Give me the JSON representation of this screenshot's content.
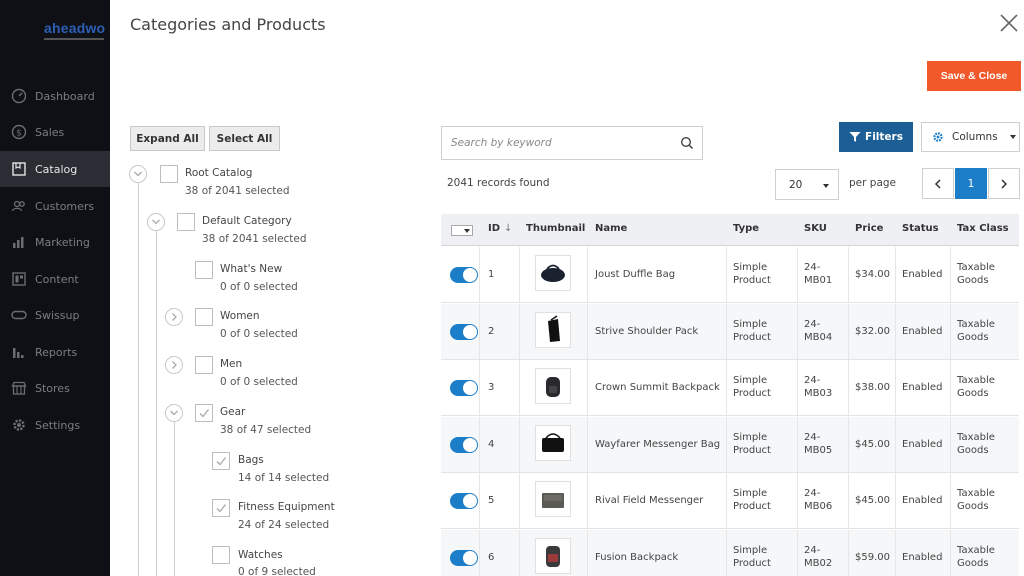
{
  "brand": {
    "logo_text": "aheadwo"
  },
  "sidebar": {
    "items": [
      {
        "label": "Dashboard",
        "icon": "dashboard-icon"
      },
      {
        "label": "Sales",
        "icon": "dollar-icon"
      },
      {
        "label": "Catalog",
        "icon": "catalog-icon",
        "active": true
      },
      {
        "label": "Customers",
        "icon": "customers-icon"
      },
      {
        "label": "Marketing",
        "icon": "marketing-icon"
      },
      {
        "label": "Content",
        "icon": "content-icon"
      },
      {
        "label": "Swissup",
        "icon": "swissup-icon"
      },
      {
        "label": "Reports",
        "icon": "reports-icon"
      },
      {
        "label": "Stores",
        "icon": "stores-icon"
      },
      {
        "label": "Settings",
        "icon": "gear-icon"
      }
    ]
  },
  "modal": {
    "title": "Categories and Products",
    "save_label": "Save & Close"
  },
  "tree": {
    "expand_all": "Expand All",
    "select_all": "Select All",
    "nodes": [
      {
        "label": "Root Catalog",
        "count": "38 of 2041 selected"
      },
      {
        "label": "Default Category",
        "count": "38 of 2041 selected"
      },
      {
        "label": "What's New",
        "count": "0 of 0 selected"
      },
      {
        "label": "Women",
        "count": "0 of 0 selected"
      },
      {
        "label": "Men",
        "count": "0 of 0 selected"
      },
      {
        "label": "Gear",
        "count": "38 of 47 selected"
      },
      {
        "label": "Bags",
        "count": "14 of 14 selected"
      },
      {
        "label": "Fitness Equipment",
        "count": "24 of 24 selected"
      },
      {
        "label": "Watches",
        "count": "0 of 9 selected"
      }
    ]
  },
  "toolbar": {
    "search_placeholder": "Search by keyword",
    "filters_label": "Filters",
    "columns_label": "Columns",
    "records_found": "2041 records found",
    "per_page_value": "20",
    "per_page_label": "per page",
    "current_page": "1"
  },
  "grid": {
    "headers": {
      "id": "ID",
      "sort": "↓",
      "thumbnail": "Thumbnail",
      "name": "Name",
      "type": "Type",
      "sku": "SKU",
      "price": "Price",
      "status": "Status",
      "tax_class": "Tax Class"
    },
    "rows": [
      {
        "id": "1",
        "name": "Joust Duffle Bag",
        "type1": "Simple",
        "type2": "Product",
        "sku1": "24-",
        "sku2": "MB01",
        "price": "$34.00",
        "status": "Enabled",
        "tax1": "Taxable",
        "tax2": "Goods",
        "thumb": "duffle-bag-icon"
      },
      {
        "id": "2",
        "name": "Strive Shoulder Pack",
        "type1": "Simple",
        "type2": "Product",
        "sku1": "24-",
        "sku2": "MB04",
        "price": "$32.00",
        "status": "Enabled",
        "tax1": "Taxable",
        "tax2": "Goods",
        "thumb": "shoulder-pack-icon"
      },
      {
        "id": "3",
        "name": "Crown Summit Backpack",
        "type1": "Simple",
        "type2": "Product",
        "sku1": "24-",
        "sku2": "MB03",
        "price": "$38.00",
        "status": "Enabled",
        "tax1": "Taxable",
        "tax2": "Goods",
        "thumb": "backpack-icon"
      },
      {
        "id": "4",
        "name": "Wayfarer Messenger Bag",
        "type1": "Simple",
        "type2": "Product",
        "sku1": "24-",
        "sku2": "MB05",
        "price": "$45.00",
        "status": "Enabled",
        "tax1": "Taxable",
        "tax2": "Goods",
        "thumb": "messenger-bag-icon"
      },
      {
        "id": "5",
        "name": "Rival Field Messenger",
        "type1": "Simple",
        "type2": "Product",
        "sku1": "24-",
        "sku2": "MB06",
        "price": "$45.00",
        "status": "Enabled",
        "tax1": "Taxable",
        "tax2": "Goods",
        "thumb": "field-messenger-icon"
      },
      {
        "id": "6",
        "name": "Fusion Backpack",
        "type1": "Simple",
        "type2": "Product",
        "sku1": "24-",
        "sku2": "MB02",
        "price": "$59.00",
        "status": "Enabled",
        "tax1": "Taxable",
        "tax2": "Goods",
        "thumb": "fusion-backpack-icon"
      }
    ]
  },
  "colors": {
    "save": "#f1592a",
    "filters": "#1b5f96",
    "active_page": "#1c7ec8",
    "toggle_on": "#1c7ec8",
    "sidebar_bg": "#0e1015"
  }
}
